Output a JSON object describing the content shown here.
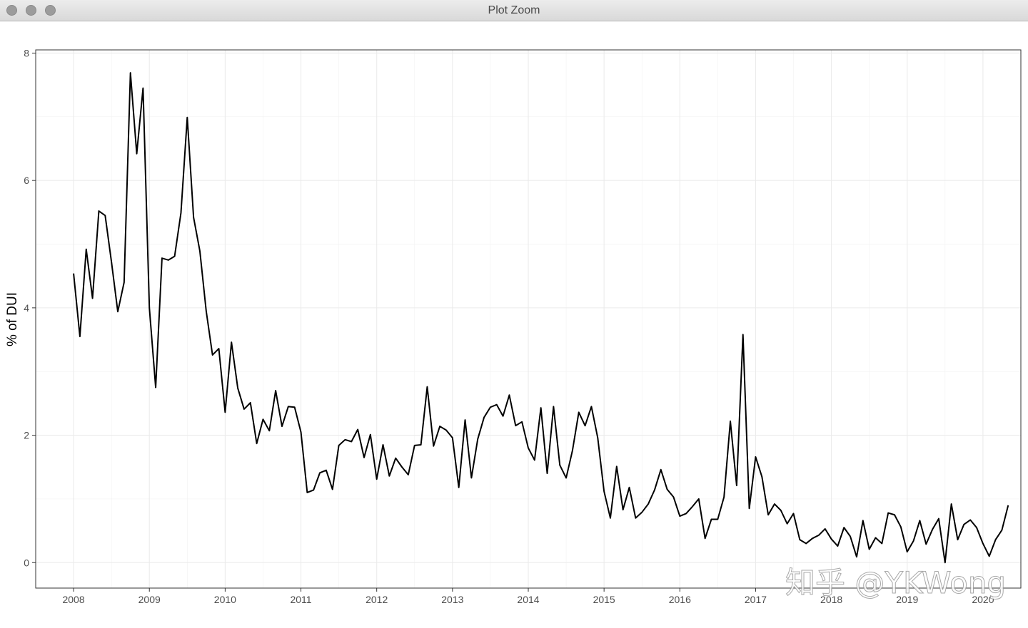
{
  "window": {
    "title": "Plot Zoom"
  },
  "watermark": "知乎 @YKWong",
  "chart_data": {
    "type": "line",
    "ylabel": "% of DUI",
    "xlabel": "",
    "xlim": [
      2007.5,
      2020.5
    ],
    "ylim": [
      -0.4,
      8.05
    ],
    "x_ticks": [
      2008,
      2009,
      2010,
      2011,
      2012,
      2013,
      2014,
      2015,
      2016,
      2017,
      2018,
      2019,
      2020
    ],
    "x_tick_labels": [
      "2008",
      "2009",
      "2010",
      "2011",
      "2012",
      "2013",
      "2014",
      "2015",
      "2016",
      "2017",
      "2018",
      "2019",
      "2020"
    ],
    "y_ticks": [
      0,
      2,
      4,
      6,
      8
    ],
    "y_tick_labels": [
      "0",
      "2",
      "4",
      "6",
      "8"
    ],
    "grid": true,
    "line_color": "#000000",
    "series": [
      {
        "x_start": 2008.0,
        "x_step": 0.08333,
        "values": [
          4.54,
          3.55,
          4.92,
          4.15,
          5.52,
          5.45,
          4.72,
          3.94,
          4.4,
          7.69,
          6.42,
          7.45,
          4.0,
          2.75,
          4.78,
          4.75,
          4.81,
          5.49,
          6.99,
          5.42,
          4.89,
          3.95,
          3.26,
          3.36,
          2.36,
          3.46,
          2.74,
          2.41,
          2.51,
          1.87,
          2.25,
          2.07,
          2.7,
          2.14,
          2.45,
          2.44,
          2.05,
          1.1,
          1.14,
          1.41,
          1.45,
          1.15,
          1.84,
          1.93,
          1.9,
          2.09,
          1.65,
          2.01,
          1.31,
          1.85,
          1.36,
          1.64,
          1.5,
          1.38,
          1.84,
          1.85,
          2.76,
          1.83,
          2.14,
          2.08,
          1.96,
          1.18,
          2.24,
          1.33,
          1.94,
          2.28,
          2.44,
          2.48,
          2.3,
          2.63,
          2.15,
          2.21,
          1.8,
          1.61,
          2.43,
          1.4,
          2.45,
          1.53,
          1.33,
          1.76,
          2.36,
          2.15,
          2.45,
          1.96,
          1.12,
          0.7,
          1.51,
          0.83,
          1.18,
          0.7,
          0.79,
          0.92,
          1.14,
          1.46,
          1.15,
          1.03,
          0.73,
          0.77,
          0.88,
          1.0,
          0.38,
          0.68,
          0.68,
          1.03,
          2.22,
          1.21,
          3.58,
          0.85,
          1.66,
          1.35,
          0.75,
          0.92,
          0.82,
          0.61,
          0.77,
          0.36,
          0.3,
          0.38,
          0.43,
          0.53,
          0.37,
          0.26,
          0.55,
          0.41,
          0.09,
          0.66,
          0.21,
          0.39,
          0.3,
          0.78,
          0.75,
          0.56,
          0.17,
          0.34,
          0.66,
          0.29,
          0.52,
          0.69,
          0.0,
          0.92,
          0.36,
          0.6,
          0.67,
          0.55,
          0.3,
          0.1,
          0.36,
          0.51,
          0.9
        ]
      }
    ]
  }
}
